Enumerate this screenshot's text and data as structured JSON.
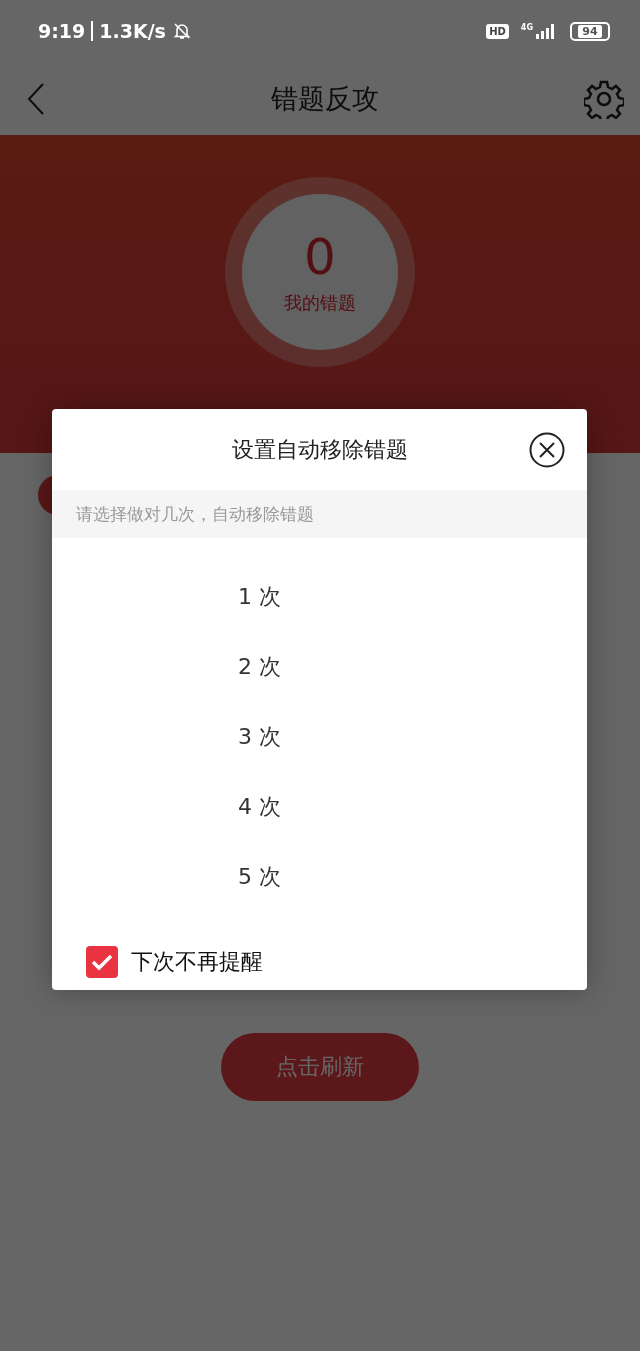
{
  "status_bar": {
    "time": "9:19",
    "speed": "1.3K/s",
    "hd": "HD",
    "network": "4G",
    "battery": "94"
  },
  "header": {
    "title": "错题反攻"
  },
  "hero": {
    "count": "0",
    "label": "我的错题"
  },
  "refresh_button": {
    "label": "点击刷新"
  },
  "dialog": {
    "title": "设置自动移除错题",
    "hint": "请选择做对几次，自动移除错题",
    "options": [
      {
        "label": "1 次"
      },
      {
        "label": "2 次"
      },
      {
        "label": "3 次"
      },
      {
        "label": "4 次"
      },
      {
        "label": "5 次"
      }
    ],
    "dont_remind": {
      "label": "下次不再提醒",
      "checked": true
    }
  }
}
